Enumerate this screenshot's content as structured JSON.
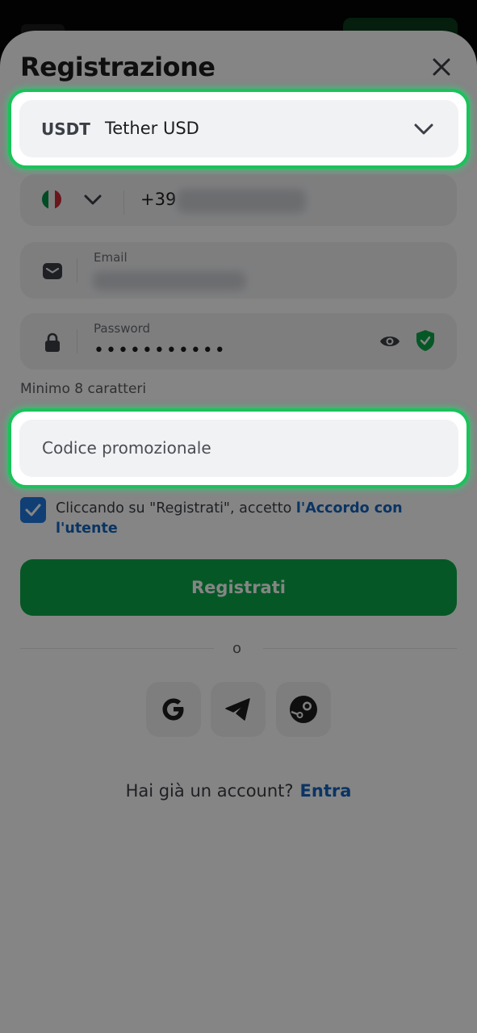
{
  "header": {
    "title": "Registrazione"
  },
  "currency": {
    "code": "USDT",
    "name": "Tether USD"
  },
  "phone": {
    "prefix": "+39"
  },
  "email": {
    "label": "Email"
  },
  "password": {
    "label": "Password",
    "masked_value": "•••••••••••",
    "hint": "Minimo 8 caratteri"
  },
  "promo": {
    "placeholder": "Codice promozionale"
  },
  "agreement": {
    "checked": true,
    "text": "Cliccando su \"Registrati\", accetto ",
    "link": "l'Accordo con l'utente"
  },
  "register_label": "Registrati",
  "divider_label": "o",
  "social": [
    "google-icon",
    "telegram-icon",
    "steam-icon"
  ],
  "login": {
    "prompt": "Hai già un account?",
    "link": "Entra"
  },
  "colors": {
    "accent_green": "#0aaa48",
    "highlight_border": "#19c35a",
    "link_blue": "#1565c0",
    "checkbox_blue": "#1f7ae0"
  }
}
